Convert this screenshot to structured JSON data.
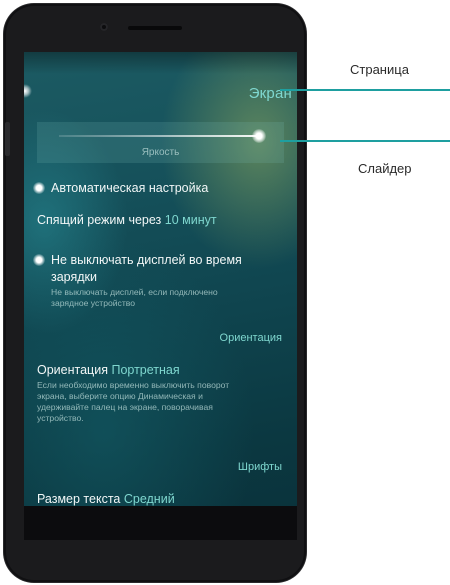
{
  "callouts": {
    "page_label": "Страница",
    "slider_label": "Слайдер"
  },
  "screen": {
    "page_title": "Экран",
    "brightness": {
      "label": "Яркость",
      "level": 0.97
    },
    "auto_adjust": {
      "label": "Автоматическая настройка",
      "enabled": true
    },
    "sleep": {
      "label": "Спящий режим через",
      "value": "10 минут"
    },
    "keep_on_charging": {
      "label_line1": "Не выключать дисплей во время",
      "label_line2": "зарядки",
      "desc_line1": "Не выключать дисплей, если подключено",
      "desc_line2": "зарядное устройство",
      "enabled": true
    },
    "orientation_section": "Ориентация",
    "orientation": {
      "label": "Ориентация",
      "value": "Портретная",
      "desc_line1": "Если необходимо временно выключить поворот",
      "desc_line2": "экрана, выберите опцию Динамическая и",
      "desc_line3": "удерживайте палец на экране, поворачивая",
      "desc_line4": "устройство."
    },
    "fonts_section": "Шрифты",
    "text_size": {
      "label": "Размер текста",
      "value": "Средний"
    }
  },
  "colors": {
    "accent": "#7fd7cf",
    "callout_line": "#1e9fa0",
    "phone_body": "#1b1b1d"
  }
}
